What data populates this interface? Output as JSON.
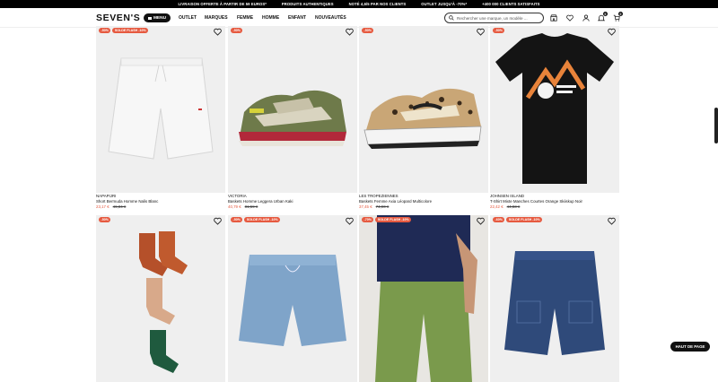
{
  "promo_bar": [
    "LIVRAISON OFFERTE À PARTIR DE 59 EUROS*",
    "PRODUITS AUTHENTIQUES",
    "NOTÉ 4,6/5 PAR NOS CLIENTS",
    "OUTLET JUSQU'À -70%*",
    "+400 000 CLIENTS SATISFAITS"
  ],
  "header": {
    "logo": "SEVEN'S",
    "menu_label": "MENU",
    "nav": [
      "OUTLET",
      "MARQUES",
      "FEMME",
      "HOMME",
      "ENFANT",
      "NOUVEAUTÉS"
    ],
    "search_placeholder": "Rechercher une marque, un modèle ...",
    "wishlist_count": "0",
    "cart_count": "0"
  },
  "products": [
    {
      "brand": "NAPAPIJRI",
      "name": "Short Bermuda Homme Nalis Blanc",
      "price": "23,17 €",
      "old_price": "46,34 €",
      "tags": [
        "-50%",
        "SOLDE FLASH -10%"
      ]
    },
    {
      "brand": "VICTORIA",
      "name": "Baskets Homme Leggera Urban Kaki",
      "price": "40,79 €",
      "old_price": "81,59 €",
      "tags": [
        "-50%"
      ]
    },
    {
      "brand": "LES TROPEZIENNES",
      "name": "Baskets Femme Axia Léopard Multicolore",
      "price": "37,45 €",
      "old_price": "74,90 €",
      "tags": [
        "-50%"
      ]
    },
    {
      "brand": "JOHNSEN ISLAND",
      "name": "T-Shirt Mixte Manches Courtes Orange Skiiskup Noir",
      "price": "22,42 €",
      "old_price": "44,83 €",
      "tags": [
        "-50%"
      ]
    },
    {
      "brand": "",
      "name": "",
      "price": "",
      "old_price": "",
      "tags": [
        "-50%"
      ]
    },
    {
      "brand": "",
      "name": "",
      "price": "",
      "old_price": "",
      "tags": [
        "-50%",
        "SOLDE FLASH -10%"
      ]
    },
    {
      "brand": "",
      "name": "",
      "price": "",
      "old_price": "",
      "tags": [
        "-70%",
        "SOLDE FLASH -10%"
      ]
    },
    {
      "brand": "",
      "name": "",
      "price": "",
      "old_price": "",
      "tags": [
        "-60%",
        "SOLDE FLASH -10%"
      ]
    }
  ],
  "back_to_top": "HAUT DE PAGE",
  "colors": {
    "accent": "#e65a40",
    "dark": "#111111"
  }
}
